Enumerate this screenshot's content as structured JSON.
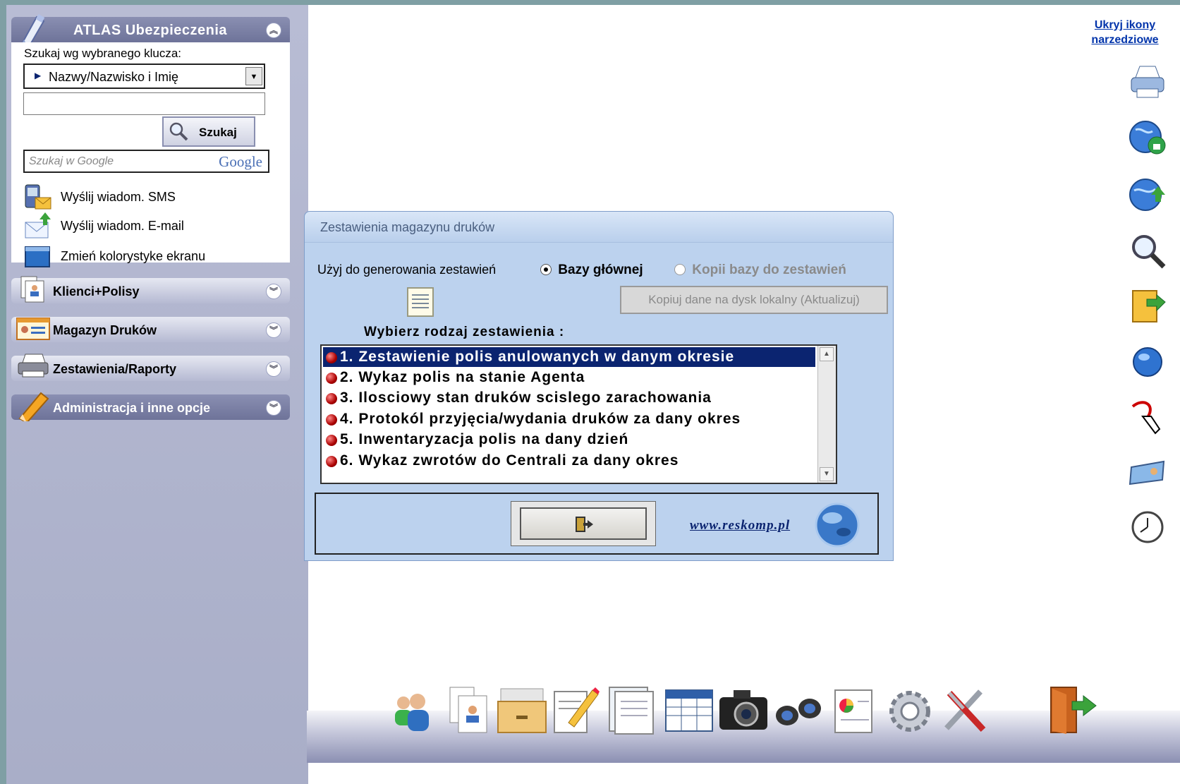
{
  "sidebar": {
    "app_title": "ATLAS Ubezpieczenia",
    "search_label": "Szukaj wg wybranego klucza:",
    "search_key_value": "Nazwy/Nazwisko i Imię",
    "search_value": "",
    "search_button": "Szukaj",
    "google_placeholder": "Szukaj w Google",
    "google_logo_text": "Google",
    "links": [
      {
        "label": "Wyślij wiadom. SMS"
      },
      {
        "label": "Wyślij wiadom. E-mail"
      },
      {
        "label": "Zmień kolorystyke ekranu"
      }
    ],
    "sections": [
      {
        "label": "Klienci+Polisy"
      },
      {
        "label": "Magazyn Druków"
      },
      {
        "label": "Zestawienia/Raporty"
      },
      {
        "label": "Administracja i inne opcje"
      }
    ]
  },
  "toolbar_right": {
    "hide_link": "Ukryj ikony narzedziowe",
    "icons": [
      "printer-icon",
      "globe-lock-icon",
      "globe-upload-icon",
      "magnifier-icon",
      "folder-arrow-icon",
      "globe-icon",
      "pointer-hand-icon",
      "id-card-icon",
      "clock-icon"
    ]
  },
  "dialog": {
    "title": "Zestawienia magazynu druków",
    "use_label": "Użyj do generowania zestawień",
    "radio_main": "Bazy głównej",
    "radio_copy": "Kopii bazy do zestawień",
    "copy_button": "Kopiuj dane na dysk lokalny (Aktualizuj)",
    "choose_label": "Wybierz rodzaj zestawienia :",
    "list_items": [
      "1. Zestawienie polis anulowanych w danym okresie",
      "2. Wykaz polis na stanie Agenta",
      "3. Ilosciowy stan druków scislego zarachowania",
      "4. Protokól przyjęcia/wydania druków za dany okres",
      "5. Inwentaryzacja polis na dany dzień",
      "6. Wykaz zwrotów do Centrali za dany okres"
    ],
    "selected_index": 0,
    "website_link": "www.reskomp.pl"
  },
  "dock": {
    "icons": [
      "users-icon",
      "client-cards-icon",
      "drawer-icon",
      "edit-document-icon",
      "documents-icon",
      "table-icon",
      "camera-icon",
      "binoculars-icon",
      "report-chart-icon",
      "settings-gear-icon",
      "tools-icon",
      "exit-door-icon"
    ]
  },
  "colors": {
    "sidebar_bg": "#b0b5cc",
    "dialog_bg": "#bcd2ee",
    "selected_row": "#0b2470",
    "link_blue": "#0033aa"
  }
}
